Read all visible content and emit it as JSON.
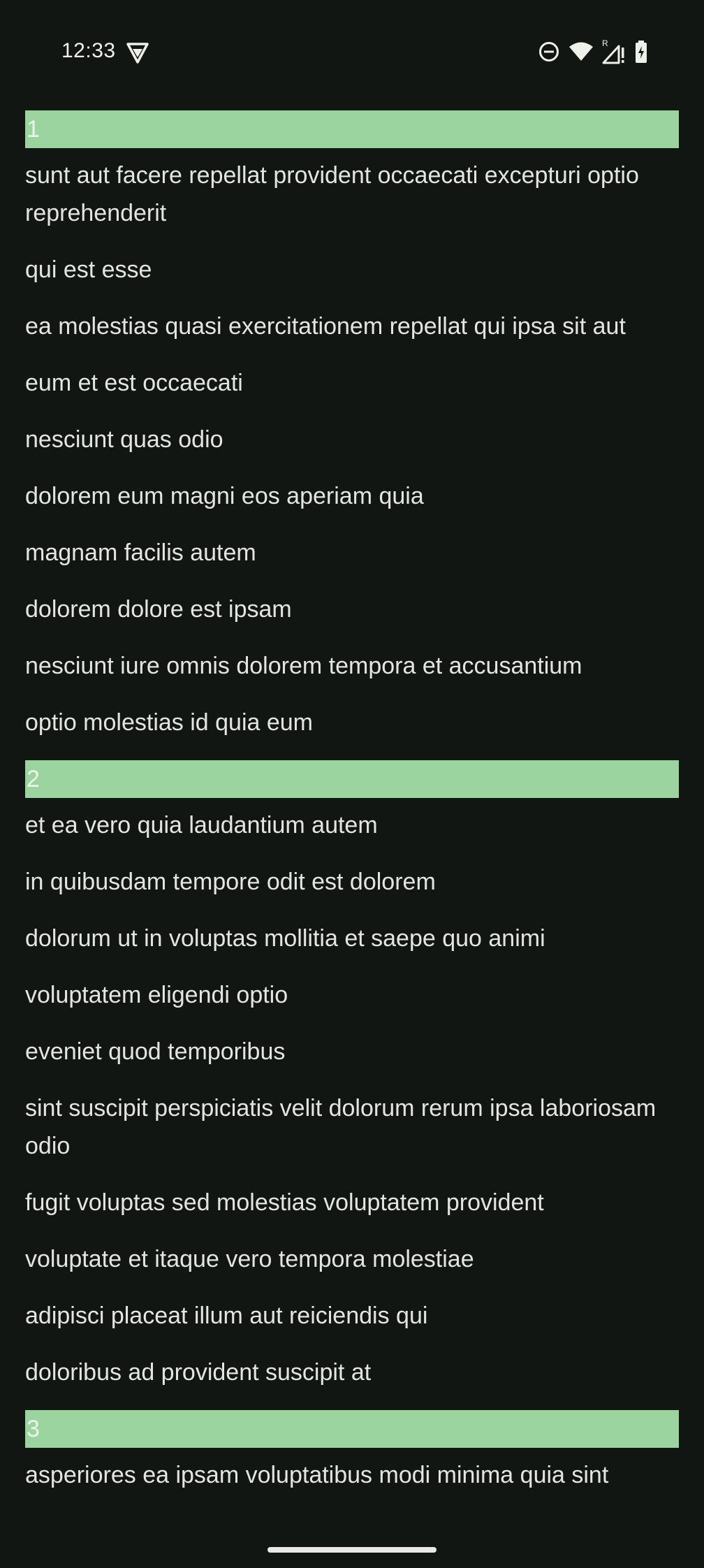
{
  "status_bar": {
    "time": "12:33",
    "icons": [
      "vpn-shield-icon",
      "do-not-disturb-icon",
      "wifi-icon",
      "signal-roaming-icon",
      "battery-charging-icon"
    ],
    "roaming_indicator": "R"
  },
  "colors": {
    "background": "#121612",
    "header_bar": "#9cd4a0",
    "text": "#e3e6e0"
  },
  "groups": [
    {
      "header": "1",
      "items": [
        "sunt aut facere repellat provident occaecati excepturi optio reprehenderit",
        "qui est esse",
        "ea molestias quasi exercitationem repellat qui ipsa sit aut",
        "eum et est occaecati",
        "nesciunt quas odio",
        "dolorem eum magni eos aperiam quia",
        "magnam facilis autem",
        "dolorem dolore est ipsam",
        "nesciunt iure omnis dolorem tempora et accusantium",
        "optio molestias id quia eum"
      ]
    },
    {
      "header": "2",
      "items": [
        "et ea vero quia laudantium autem",
        "in quibusdam tempore odit est dolorem",
        "dolorum ut in voluptas mollitia et saepe quo animi",
        "voluptatem eligendi optio",
        "eveniet quod temporibus",
        "sint suscipit perspiciatis velit dolorum rerum ipsa laboriosam odio",
        "fugit voluptas sed molestias voluptatem provident",
        "voluptate et itaque vero tempora molestiae",
        "adipisci placeat illum aut reiciendis qui",
        "doloribus ad provident suscipit at"
      ]
    },
    {
      "header": "3",
      "items": [
        "asperiores ea ipsam voluptatibus modi minima quia sint"
      ]
    }
  ]
}
